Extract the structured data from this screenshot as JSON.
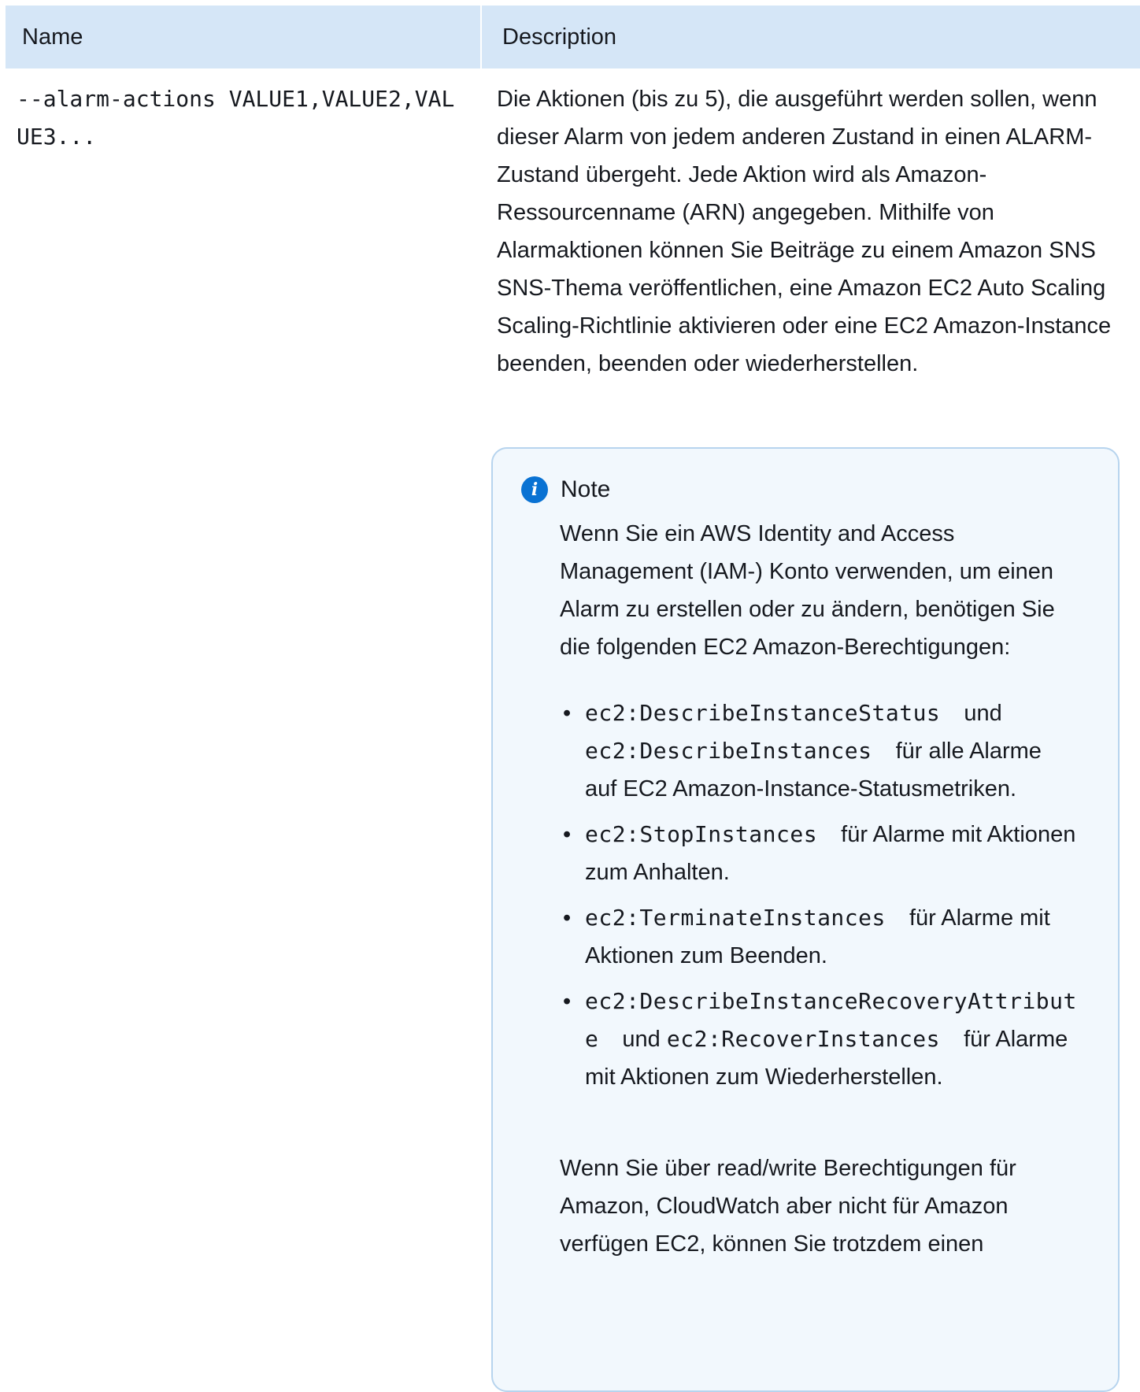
{
  "table": {
    "headers": {
      "name": "Name",
      "description": "Description"
    },
    "row": {
      "name": "--alarm-actions  VALUE1,VALUE2,VALUE3...",
      "description": "Die Aktionen (bis zu 5), die ausgeführt werden sollen, wenn dieser Alarm von jedem anderen Zustand in einen ALARM-Zustand übergeht. Jede Aktion wird als Amazon-Ressourcenname (ARN) angegeben. Mithilfe von Alarmaktionen können Sie Beiträge zu einem Amazon SNS SNS-Thema veröffentlichen, eine Amazon EC2 Auto Scaling Scaling-Richtlinie aktivieren oder eine EC2 Amazon-Instance beenden, beenden oder wiederherstellen."
    }
  },
  "note": {
    "icon": "info-icon",
    "icon_glyph": "i",
    "title": "Note",
    "intro": "Wenn Sie ein AWS Identity and Access Management (IAM-) Konto verwenden, um einen Alarm zu erstellen oder zu ändern, benötigen Sie die folgenden EC2 Amazon-Berechtigungen:",
    "items": [
      {
        "code1": "ec2:DescribeInstanceStatus",
        "mid": "und",
        "code2": "ec2:DescribeInstances",
        "text": "für alle Alarme auf EC2 Amazon-Instance-Statusmetriken."
      },
      {
        "code1": "ec2:StopInstances",
        "text": "für Alarme mit Aktionen zum Anhalten."
      },
      {
        "code1": "ec2:TerminateInstances",
        "text": "für Alarme mit Aktionen zum Beenden."
      },
      {
        "code1": "ec2:DescribeInstanceRecoveryAttribute",
        "mid": "und",
        "code2": "ec2:RecoverInstances",
        "text": "für Alarme mit Aktionen zum Wiederherstellen."
      }
    ],
    "outro": "Wenn Sie über read/write Berechtigungen für Amazon, CloudWatch aber nicht für Amazon verfügen EC2, können Sie trotzdem einen"
  }
}
